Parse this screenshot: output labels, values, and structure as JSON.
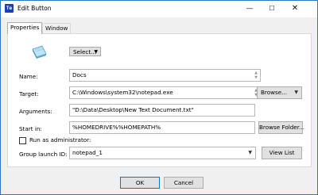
{
  "window": {
    "title": "Edit Button",
    "app_icon_text": "Te"
  },
  "titlebar": {
    "minimize": "—",
    "maximize": "☐",
    "close": "✕"
  },
  "tabs": [
    {
      "label": "Properties"
    },
    {
      "label": "Window"
    }
  ],
  "icon_select": {
    "label": "Select...",
    "icon": "notepad-icon"
  },
  "form": {
    "name": {
      "label": "Name:",
      "value": "Docs"
    },
    "target": {
      "label": "Target:",
      "value": "C:\\Windows\\system32\\notepad.exe",
      "button": "Browse..."
    },
    "arguments": {
      "label": "Arguments:",
      "value": "\"D:\\Data\\Desktop\\New Text Document.txt\""
    },
    "start_in": {
      "label": "Start in:",
      "value": "%HOMEDRIVE%%HOMEPATH%",
      "button": "Browse Folder..."
    },
    "run_as_admin": {
      "label": "Run as administrator:",
      "checked": false
    },
    "group_launch_id": {
      "label": "Group launch ID:",
      "value": "notepad_1",
      "button": "View List"
    }
  },
  "footer": {
    "ok": "OK",
    "cancel": "Cancel"
  },
  "colors": {
    "accent": "#0078d7",
    "app_icon_bg": "#1c3fb8"
  }
}
